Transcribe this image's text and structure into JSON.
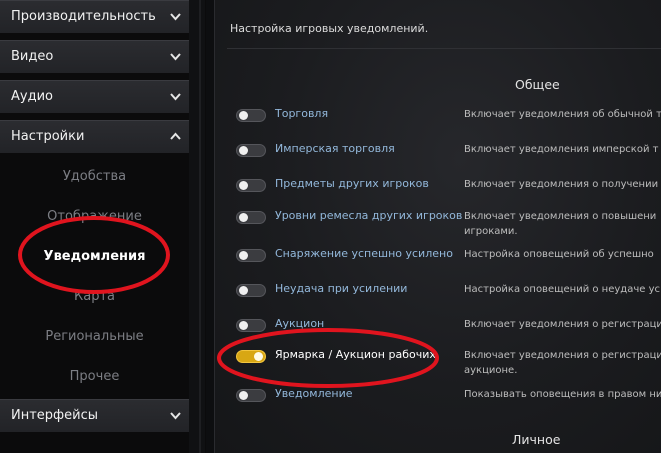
{
  "sidebar": {
    "sections": [
      {
        "label": "Производительность",
        "state": "collapsed"
      },
      {
        "label": "Видео",
        "state": "collapsed"
      },
      {
        "label": "Аудио",
        "state": "collapsed"
      },
      {
        "label": "Настройки",
        "state": "expanded"
      },
      {
        "label": "Интерфейсы",
        "state": "collapsed"
      }
    ],
    "subitems": [
      {
        "label": "Удобства"
      },
      {
        "label": "Отображение"
      },
      {
        "label": "Уведомления",
        "active": true
      },
      {
        "label": "Карта"
      },
      {
        "label": "Региональные"
      },
      {
        "label": "Прочее"
      }
    ]
  },
  "main": {
    "title": "Настройка игровых уведомлений.",
    "group_general": "Общее",
    "group_personal": "Личное",
    "rows": [
      {
        "label": "Торговля",
        "desc": "Включает уведомления об обычной т",
        "desc2": "",
        "on": false
      },
      {
        "label": "Имперская торговля",
        "desc": "Включает уведомления имперской т",
        "desc2": "",
        "on": false
      },
      {
        "label": "Предметы других игроков",
        "desc": "Включает уведомления о получении",
        "desc2": "",
        "on": false
      },
      {
        "label": "Уровни ремесла других игроков",
        "desc": "Включает уведомления о повышени",
        "desc2": "игроками.",
        "on": false
      },
      {
        "label": "Снаряжение успешно усилено",
        "desc": "Настройка оповещений об успешно",
        "desc2": "",
        "on": false
      },
      {
        "label": "Неудача при усилении",
        "desc": "Настройка оповещений о неудаче ус",
        "desc2": "",
        "on": false
      },
      {
        "label": "Аукцион",
        "desc": "Включает уведомления о регистраци",
        "desc2": "",
        "on": false
      },
      {
        "label": "Ярмарка / Аукцион рабочих",
        "desc": "Включает уведомления о регистраци",
        "desc2": "аукционе.",
        "on": true
      },
      {
        "label": "Уведомление",
        "desc": "Показывать оповещения в правом ни",
        "desc2": "",
        "on": false
      }
    ]
  },
  "colors": {
    "accent_toggle_on": "#d8a714",
    "label_blue": "#93b8db",
    "annotation_red": "#e0141e"
  }
}
